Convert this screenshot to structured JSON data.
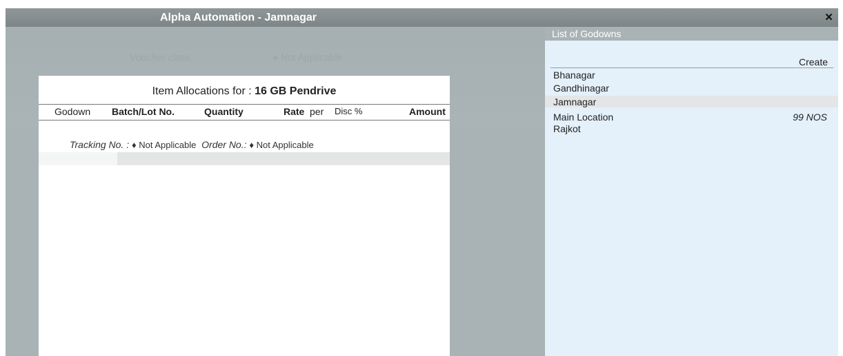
{
  "window": {
    "title": "Alpha Automation - Jamnagar",
    "close_glyph": "×"
  },
  "voucher_class": {
    "label": "Voucher class",
    "value": "♦ Not Applicable"
  },
  "allocation": {
    "title_prefix": "Item Allocations for :",
    "item_name": "16 GB Pendrive",
    "columns": {
      "godown": "Godown",
      "batch": "Batch/Lot No.",
      "quantity": "Quantity",
      "rate": "Rate",
      "per": "per",
      "disc": "Disc %",
      "amount": "Amount"
    },
    "tracking_label": "Tracking No. :",
    "tracking_value": "♦ Not Applicable",
    "order_label": "Order No.:",
    "order_value": "♦ Not Applicable"
  },
  "godown_list": {
    "header": "List of Godowns",
    "create_label": "Create",
    "items": [
      {
        "name": "Bhanagar",
        "qty": ""
      },
      {
        "name": "Gandhinagar",
        "qty": ""
      },
      {
        "name": "Jamnagar",
        "qty": ""
      },
      {
        "name": "Main Location",
        "qty": "99 NOS"
      },
      {
        "name": "Rajkot",
        "qty": ""
      }
    ],
    "selected_index": 2
  },
  "colors": {
    "background": "#a9b3b5",
    "title_bar": "#858d8f",
    "list_panel": "#e4f0fa",
    "selection": "#e4e5e6"
  }
}
